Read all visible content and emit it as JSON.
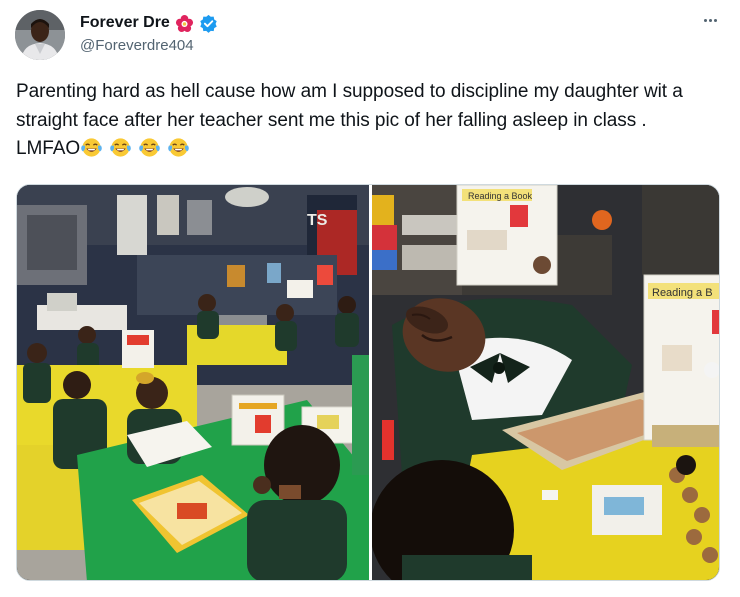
{
  "author": {
    "display_name": "Forever Dre",
    "handle": "@Foreverdre404",
    "badge_icons": [
      "flower-emoji-icon",
      "verified-badge-icon"
    ]
  },
  "menu": {
    "icon": "more-options-icon"
  },
  "tweet": {
    "text": "Parenting hard as hell cause how am I supposed to discipline my daughter wit a straight face after her teacher sent me this pic of her falling asleep in class . LMFAO",
    "emojis": [
      "tears-of-joy-emoji",
      "tears-of-joy-emoji",
      "tears-of-joy-emoji",
      "tears-of-joy-emoji"
    ]
  },
  "media": {
    "photos": [
      {
        "name": "classroom-wide-photo",
        "book_sign_label": "Reading a Book",
        "wall_letters": "TS"
      },
      {
        "name": "sleeping-child-photo",
        "book_sign_label": "Reading a Book",
        "sign_label_cropped": "Reading a B"
      }
    ]
  },
  "colors": {
    "text_primary": "#0f1419",
    "text_secondary": "#536471",
    "verified_blue": "#1d9bf0",
    "border": "#cfd9de",
    "uniform_green": "#1f3a2c",
    "table_yellow": "#e6d21f",
    "tablecloth_green": "#21a24a"
  }
}
